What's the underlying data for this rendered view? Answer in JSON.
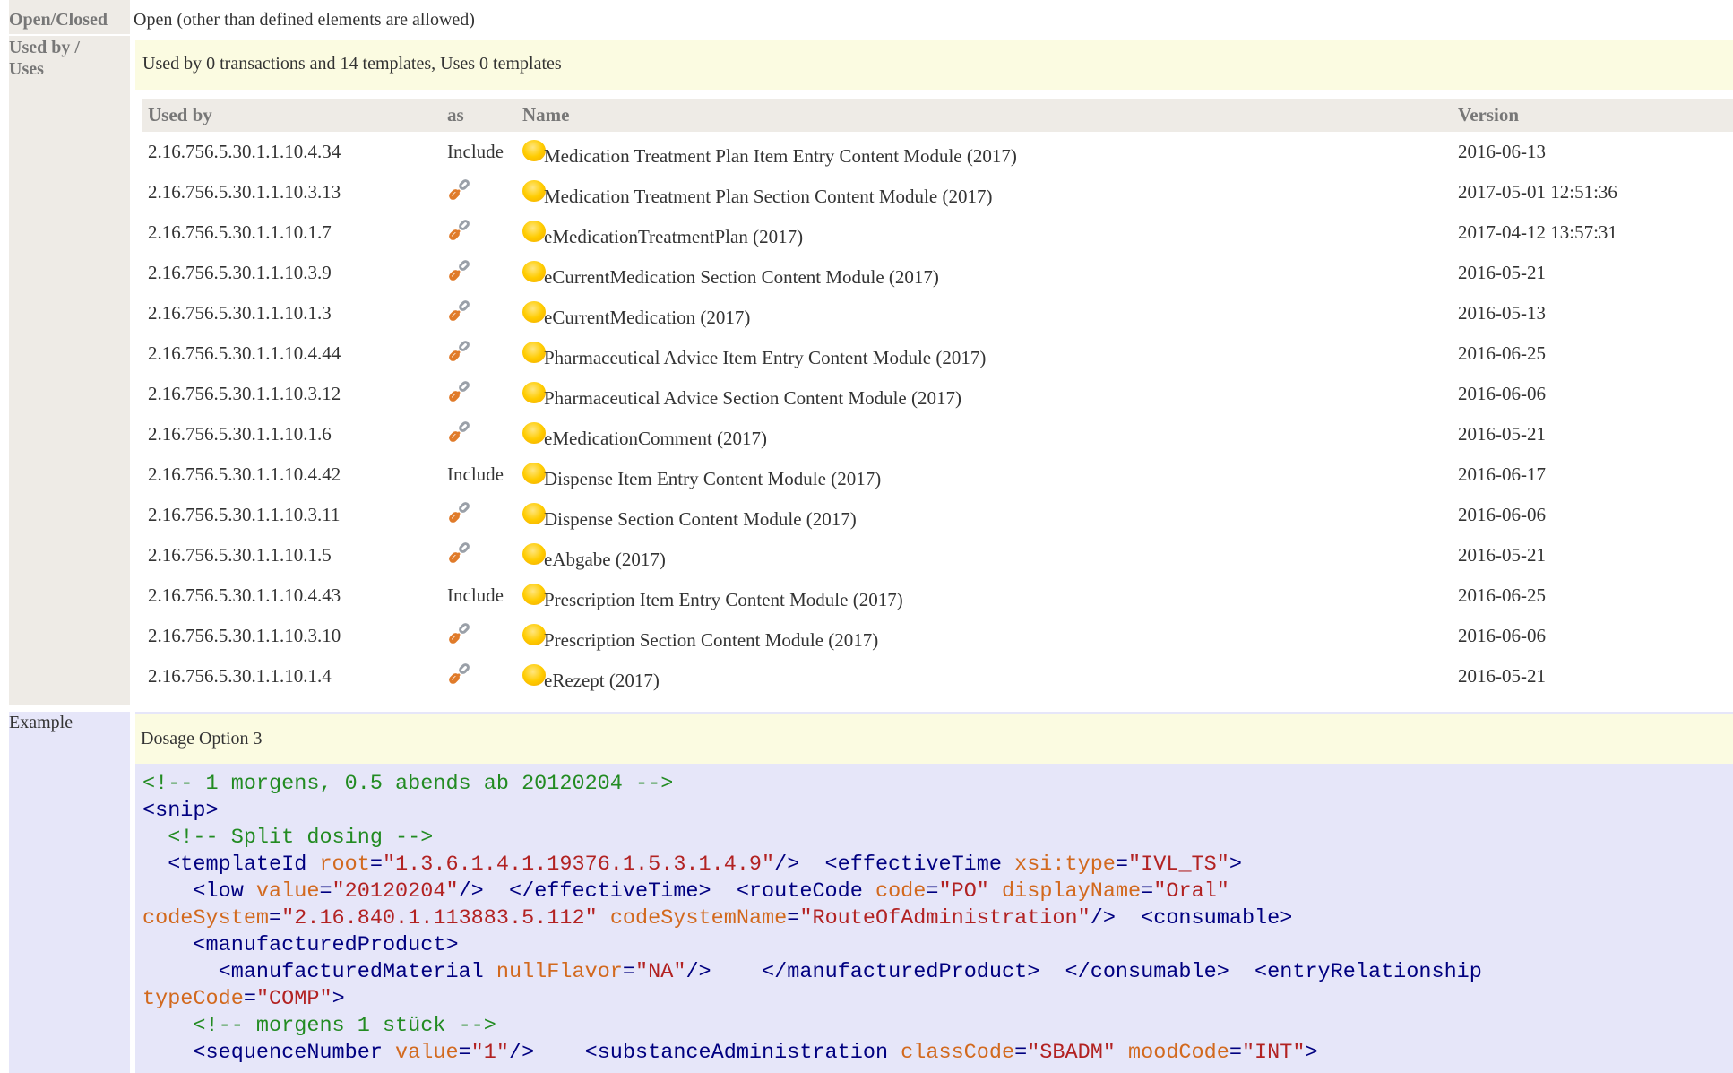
{
  "open_closed": {
    "label": "Open/Closed",
    "value": "Open (other than defined elements are allowed)"
  },
  "used_by": {
    "label": "Used by / Uses",
    "summary": "Used by 0 transactions and 14 templates, Uses 0 templates",
    "columns": [
      "Used by",
      "as",
      "Name",
      "Version"
    ],
    "rows": [
      {
        "id": "2.16.756.5.30.1.1.10.4.34",
        "as": "Include",
        "name": "Medication Treatment Plan Item Entry Content Module (2017)",
        "version": "2016-06-13"
      },
      {
        "id": "2.16.756.5.30.1.1.10.3.13",
        "as": "link",
        "name": "Medication Treatment Plan Section Content Module (2017)",
        "version": "2017-05-01 12:51:36"
      },
      {
        "id": "2.16.756.5.30.1.1.10.1.7",
        "as": "link",
        "name": "eMedicationTreatmentPlan (2017)",
        "version": "2017-04-12 13:57:31"
      },
      {
        "id": "2.16.756.5.30.1.1.10.3.9",
        "as": "link",
        "name": "eCurrentMedication Section Content Module (2017)",
        "version": "2016-05-21"
      },
      {
        "id": "2.16.756.5.30.1.1.10.1.3",
        "as": "link",
        "name": "eCurrentMedication (2017)",
        "version": "2016-05-13"
      },
      {
        "id": "2.16.756.5.30.1.1.10.4.44",
        "as": "link",
        "name": "Pharmaceutical Advice Item Entry Content Module (2017)",
        "version": "2016-06-25"
      },
      {
        "id": "2.16.756.5.30.1.1.10.3.12",
        "as": "link",
        "name": "Pharmaceutical Advice Section Content Module (2017)",
        "version": "2016-06-06"
      },
      {
        "id": "2.16.756.5.30.1.1.10.1.6",
        "as": "link",
        "name": "eMedicationComment (2017)",
        "version": "2016-05-21"
      },
      {
        "id": "2.16.756.5.30.1.1.10.4.42",
        "as": "Include",
        "name": "Dispense Item Entry Content Module (2017)",
        "version": "2016-06-17"
      },
      {
        "id": "2.16.756.5.30.1.1.10.3.11",
        "as": "link",
        "name": "Dispense Section Content Module (2017)",
        "version": "2016-06-06"
      },
      {
        "id": "2.16.756.5.30.1.1.10.1.5",
        "as": "link",
        "name": "eAbgabe (2017)",
        "version": "2016-05-21"
      },
      {
        "id": "2.16.756.5.30.1.1.10.4.43",
        "as": "Include",
        "name": "Prescription Item Entry Content Module (2017)",
        "version": "2016-06-25"
      },
      {
        "id": "2.16.756.5.30.1.1.10.3.10",
        "as": "link",
        "name": "Prescription Section Content Module (2017)",
        "version": "2016-06-06"
      },
      {
        "id": "2.16.756.5.30.1.1.10.1.4",
        "as": "link",
        "name": "eRezept (2017)",
        "version": "2016-05-21"
      }
    ]
  },
  "example": {
    "label": "Example",
    "title": "Dosage Option 3",
    "code_lines": [
      [
        [
          "cm",
          "<!-- 1 morgens, 0.5 abends ab 20120204 -->"
        ]
      ],
      [
        [
          "tg",
          "<snip>"
        ]
      ],
      [
        [
          "tg",
          "  "
        ],
        [
          "cm",
          "<!-- Split dosing -->"
        ]
      ],
      [
        [
          "tg",
          "  <templateId "
        ],
        [
          "at",
          "root"
        ],
        [
          "tg",
          "="
        ],
        [
          "av",
          "\"1.3.6.1.4.1.19376.1.5.3.1.4.9\""
        ],
        [
          "tg",
          "/>  <effectiveTime "
        ],
        [
          "at",
          "xsi:type"
        ],
        [
          "tg",
          "="
        ],
        [
          "av",
          "\"IVL_TS\""
        ],
        [
          "tg",
          ">"
        ]
      ],
      [
        [
          "tg",
          "    <low "
        ],
        [
          "at",
          "value"
        ],
        [
          "tg",
          "="
        ],
        [
          "av",
          "\"20120204\""
        ],
        [
          "tg",
          "/>  </effectiveTime>  <routeCode "
        ],
        [
          "at",
          "code"
        ],
        [
          "tg",
          "="
        ],
        [
          "av",
          "\"PO\""
        ],
        [
          "tg",
          " "
        ],
        [
          "at",
          "displayName"
        ],
        [
          "tg",
          "="
        ],
        [
          "av",
          "\"Oral\""
        ]
      ],
      [
        [
          "at",
          "codeSystem"
        ],
        [
          "tg",
          "="
        ],
        [
          "av",
          "\"2.16.840.1.113883.5.112\""
        ],
        [
          "tg",
          " "
        ],
        [
          "at",
          "codeSystemName"
        ],
        [
          "tg",
          "="
        ],
        [
          "av",
          "\"RouteOfAdministration\""
        ],
        [
          "tg",
          "/>  <consumable>"
        ]
      ],
      [
        [
          "tg",
          "    <manufacturedProduct>"
        ]
      ],
      [
        [
          "tg",
          "      <manufacturedMaterial "
        ],
        [
          "at",
          "nullFlavor"
        ],
        [
          "tg",
          "="
        ],
        [
          "av",
          "\"NA\""
        ],
        [
          "tg",
          "/>    </manufacturedProduct>  </consumable>  <entryRelationship"
        ]
      ],
      [
        [
          "at",
          "typeCode"
        ],
        [
          "tg",
          "="
        ],
        [
          "av",
          "\"COMP\""
        ],
        [
          "tg",
          ">"
        ]
      ],
      [
        [
          "tg",
          "    "
        ],
        [
          "cm",
          "<!-- morgens 1 stück -->"
        ]
      ],
      [
        [
          "tg",
          "    <sequenceNumber "
        ],
        [
          "at",
          "value"
        ],
        [
          "tg",
          "="
        ],
        [
          "av",
          "\"1\""
        ],
        [
          "tg",
          "/>    <substanceAdministration "
        ],
        [
          "at",
          "classCode"
        ],
        [
          "tg",
          "="
        ],
        [
          "av",
          "\"SBADM\""
        ],
        [
          "tg",
          " "
        ],
        [
          "at",
          "moodCode"
        ],
        [
          "tg",
          "="
        ],
        [
          "av",
          "\"INT\""
        ],
        [
          "tg",
          ">"
        ]
      ]
    ]
  }
}
